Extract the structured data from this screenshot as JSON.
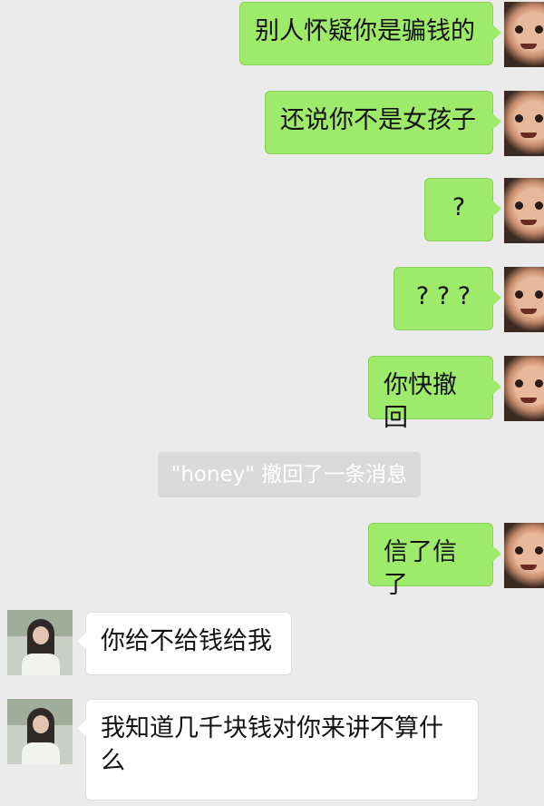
{
  "messages": [
    {
      "side": "me",
      "text": "别人怀疑你是骗钱的"
    },
    {
      "side": "me",
      "text": "还说你不是女孩子"
    },
    {
      "side": "me",
      "text": "?"
    },
    {
      "side": "me",
      "text": "? ? ?"
    },
    {
      "side": "me",
      "text": "你快撤回"
    },
    {
      "side": "system",
      "text": "\"honey\" 撤回了一条消息"
    },
    {
      "side": "me",
      "text": "信了信了"
    },
    {
      "side": "them",
      "text": "你给不给钱给我"
    },
    {
      "side": "them",
      "text": "我知道几千块钱对你来讲不算什么"
    }
  ],
  "colors": {
    "background": "#ebebeb",
    "sent_bubble": "#9eea6a",
    "received_bubble": "#ffffff",
    "system_notice_bg": "#dadada"
  }
}
